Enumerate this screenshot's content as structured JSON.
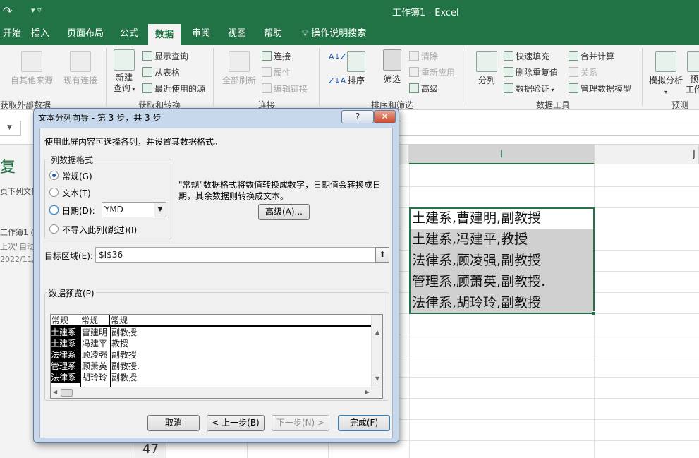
{
  "window": {
    "title": "工作簿1  -  Excel",
    "qat_undo": "↷",
    "qat_more": "▾  ▿"
  },
  "tabs": [
    {
      "label": "开始"
    },
    {
      "label": "插入"
    },
    {
      "label": "页面布局"
    },
    {
      "label": "公式"
    },
    {
      "label": "数据",
      "active": true
    },
    {
      "label": "审阅"
    },
    {
      "label": "视图"
    },
    {
      "label": "帮助"
    },
    {
      "label": "操作说明搜索"
    }
  ],
  "ribbon": {
    "get_external": {
      "from_other": "自其他来源",
      "existing": "现有连接",
      "group": "获取外部数据"
    },
    "get_transform": {
      "new_query": "新建",
      "new_query2": "查询",
      "show_queries": "显示查询",
      "from_table": "从表格",
      "recent_sources": "最近使用的源",
      "group": "获取和转换"
    },
    "connections": {
      "refresh_all": "全部刷新",
      "connections": "连接",
      "properties": "属性",
      "edit_links": "编辑链接",
      "group": "连接"
    },
    "sort_filter": {
      "sort": "排序",
      "filter": "筛选",
      "clear": "清除",
      "reapply": "重新应用",
      "advanced": "高级",
      "group": "排序和筛选"
    },
    "data_tools": {
      "split": "分列",
      "flash_fill": "快速填充",
      "remove_dup": "删除重复值",
      "validation": "数据验证",
      "consolidate": "合并计算",
      "relationships": "关系",
      "data_model": "管理数据模型",
      "group": "数据工具"
    },
    "forecast": {
      "whatif": "模拟分析",
      "sheet": "预",
      "sheet2": "工作",
      "group": "预测"
    }
  },
  "left_panel": {
    "heading": "复",
    "line1": "页下列文件",
    "line2": "工作簿1 (",
    "line3": "上次\"自动",
    "line4": "2022/11/"
  },
  "sheet": {
    "column_headers": [
      "I",
      "J"
    ],
    "row_number": "47",
    "cells": [
      "土建系,曹建明,副教授",
      "土建系,冯建平,教授",
      "法律系,顾凌强,副教授",
      "管理系,顾萧英,副教授.",
      "法律系,胡玲玲,副教授"
    ]
  },
  "dialog": {
    "title": "文本分列向导 - 第 3 步，共 3 步",
    "help_label": "?",
    "close_label": "✕",
    "intro": "使用此屏内容可选择各列，并设置其数据格式。",
    "group_label": "列数据格式",
    "radio_general": "常规(G)",
    "radio_text": "文本(T)",
    "radio_date": "日期(D):",
    "radio_skip": "不导入此列(跳过)(I)",
    "date_format": "YMD",
    "note_line1": "\"常规\"数据格式将数值转换成数字，日期值会转换成日",
    "note_line2": "期，其余数据则转换成文本。",
    "advanced_button": "高级(A)...",
    "dest_label": "目标区域(E):",
    "dest_value": "$I$36",
    "preview_label": "数据预览(P)",
    "preview_headers": [
      "常规",
      "常规",
      "常规"
    ],
    "preview_rows": [
      [
        "土建系",
        "曹建明",
        "副教授"
      ],
      [
        "土建系",
        "冯建平",
        "教授"
      ],
      [
        "法律系",
        "顾凌强",
        "副教授"
      ],
      [
        "管理系",
        "顾萧英",
        "副教授."
      ],
      [
        "法律系",
        "胡玲玲",
        "副教授"
      ]
    ],
    "buttons": {
      "cancel": "取消",
      "back": "< 上一步(B)",
      "next": "下一步(N) >",
      "finish": "完成(F)"
    }
  }
}
